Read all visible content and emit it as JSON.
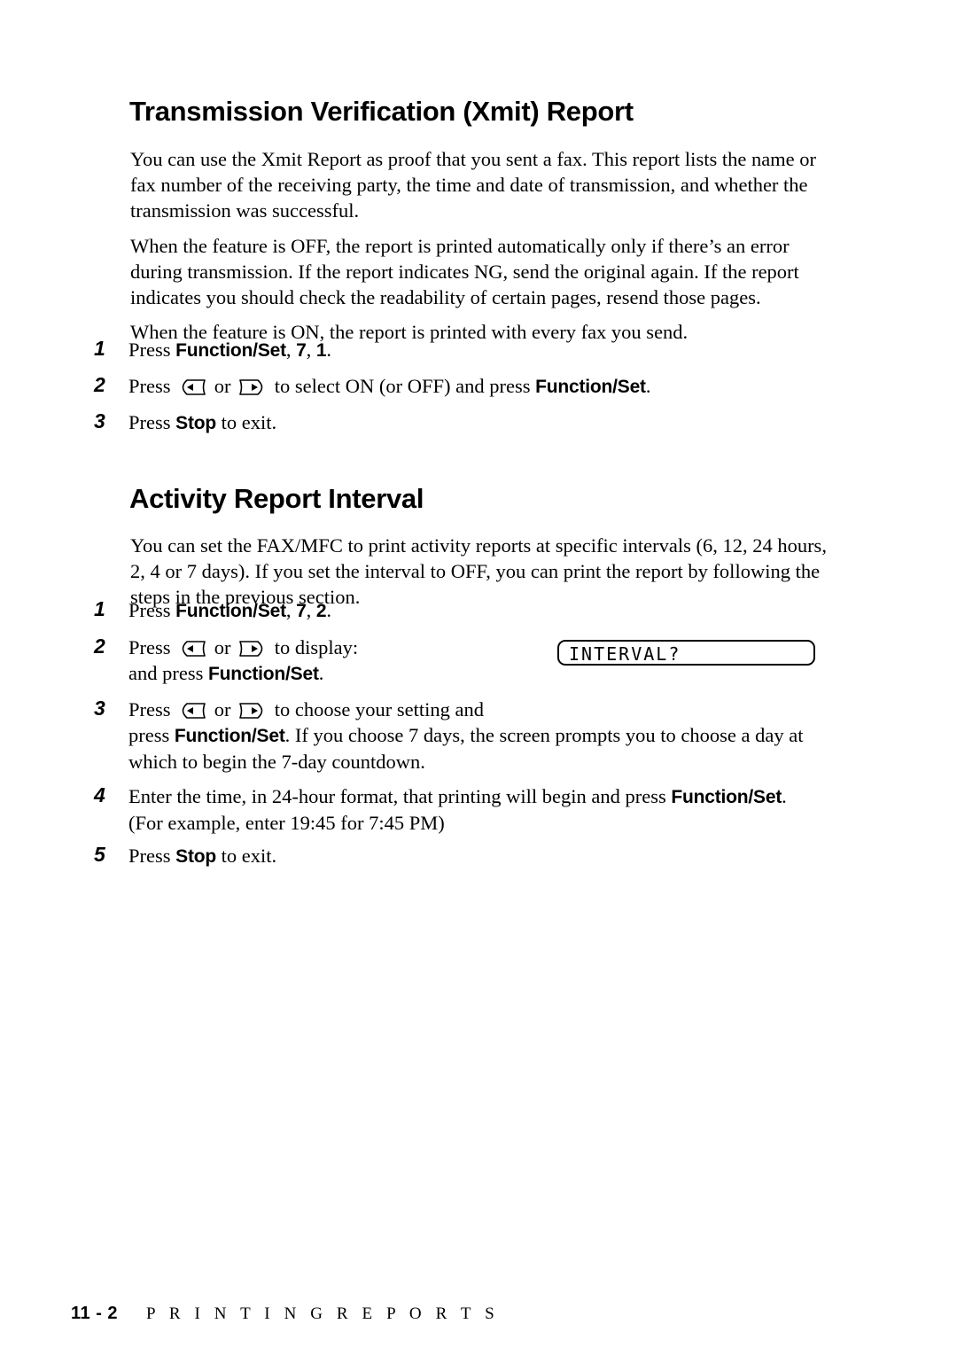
{
  "document": {
    "sections": [
      {
        "id": "xmit",
        "heading": "Transmission Verification (Xmit) Report",
        "paragraphs": [
          "You can use the Xmit Report as proof that you sent a fax.  This report lists the name or fax number of the receiving party, the time and date of transmission, and whether the transmission was successful.",
          "When the feature is OFF, the report is printed automatically only if there’s an error during transmission.  If the report indicates NG, send the original again.  If the report indicates you should check the readability of certain pages, resend those pages.",
          "When the feature is ON, the report is printed with every fax you send."
        ],
        "steps": [
          {
            "number": "1",
            "parts": [
              {
                "type": "text",
                "text": "Press "
              },
              {
                "type": "bold",
                "text": "Function/Set"
              },
              {
                "type": "text",
                "text": ", "
              },
              {
                "type": "bold",
                "text": "7"
              },
              {
                "type": "text",
                "text": ", "
              },
              {
                "type": "bold",
                "text": "1"
              },
              {
                "type": "text",
                "text": "."
              }
            ]
          },
          {
            "number": "2",
            "parts": [
              {
                "type": "text",
                "text": "Press "
              },
              {
                "type": "icon",
                "icon": "left-arrow-key-icon"
              },
              {
                "type": "text",
                "text": " or "
              },
              {
                "type": "icon",
                "icon": "right-arrow-key-icon"
              },
              {
                "type": "text",
                "text": " to select ON (or OFF) and press "
              },
              {
                "type": "bold",
                "text": "Function/Set"
              },
              {
                "type": "text",
                "text": "."
              }
            ]
          },
          {
            "number": "3",
            "parts": [
              {
                "type": "text",
                "text": "Press "
              },
              {
                "type": "bold",
                "text": "Stop"
              },
              {
                "type": "text",
                "text": " to exit."
              }
            ]
          }
        ]
      },
      {
        "id": "activity",
        "heading": "Activity Report Interval",
        "paragraphs": [
          "You can set the FAX/MFC to print activity reports at specific intervals (6, 12, 24 hours, 2, 4 or 7 days).  If you set the interval to OFF, you can print the report by following the steps in the previous section."
        ],
        "steps": [
          {
            "number": "1",
            "parts": [
              {
                "type": "text",
                "text": "Press "
              },
              {
                "type": "bold",
                "text": "Function/Set"
              },
              {
                "type": "text",
                "text": ", "
              },
              {
                "type": "bold",
                "text": "7"
              },
              {
                "type": "text",
                "text": ", "
              },
              {
                "type": "bold",
                "text": "2"
              },
              {
                "type": "text",
                "text": "."
              }
            ]
          },
          {
            "number": "2",
            "narrow": true,
            "parts": [
              {
                "type": "text",
                "text": "Press "
              },
              {
                "type": "icon",
                "icon": "left-arrow-key-icon"
              },
              {
                "type": "text",
                "text": " or "
              },
              {
                "type": "icon",
                "icon": "right-arrow-key-icon"
              },
              {
                "type": "text",
                "text": " to display:"
              },
              {
                "type": "break"
              },
              {
                "type": "text",
                "text": "and press "
              },
              {
                "type": "bold",
                "text": "Function/Set"
              },
              {
                "type": "text",
                "text": "."
              }
            ]
          },
          {
            "number": "3",
            "parts": [
              {
                "type": "text",
                "text": "Press "
              },
              {
                "type": "icon",
                "icon": "left-arrow-key-icon"
              },
              {
                "type": "text",
                "text": " or "
              },
              {
                "type": "icon",
                "icon": "right-arrow-key-icon"
              },
              {
                "type": "text",
                "text": " to choose your setting and"
              },
              {
                "type": "break"
              },
              {
                "type": "text",
                "text": "press "
              },
              {
                "type": "bold",
                "text": "Function/Set"
              },
              {
                "type": "text",
                "text": ".  If you choose 7 days, the screen prompts you to choose a day at which to begin the 7-day countdown."
              }
            ]
          },
          {
            "number": "4",
            "parts": [
              {
                "type": "text",
                "text": "Enter the time, in 24-hour format, that printing will begin and press "
              },
              {
                "type": "bold",
                "text": "Function/Set"
              },
              {
                "type": "text",
                "text": "."
              },
              {
                "type": "break"
              },
              {
                "type": "text",
                "text": "(For example, enter 19:45 for 7:45 PM)"
              }
            ]
          },
          {
            "number": "5",
            "parts": [
              {
                "type": "text",
                "text": "Press "
              },
              {
                "type": "bold",
                "text": "Stop"
              },
              {
                "type": "text",
                "text": " to exit."
              }
            ]
          }
        ]
      }
    ],
    "lcd_display": {
      "text": "INTERVAL?"
    },
    "footer": {
      "page_number": "11 - 2",
      "chapter_title": "P R I N T I N G   R E P O R T S"
    }
  }
}
